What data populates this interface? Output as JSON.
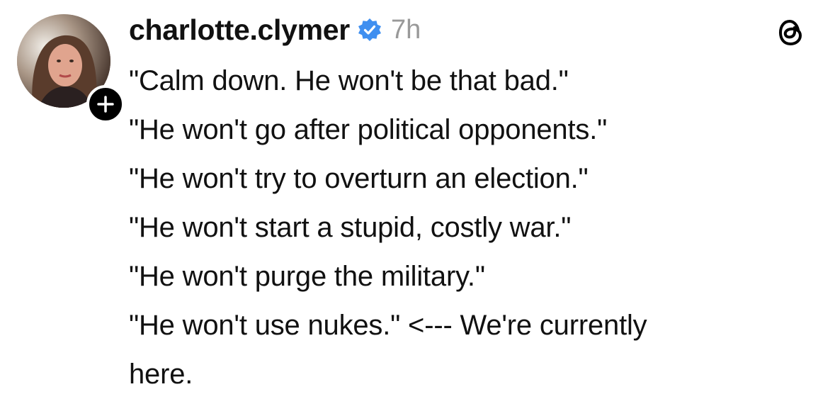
{
  "post": {
    "author": {
      "username": "charlotte.clymer",
      "verified": true,
      "avatar_icon": "profile-photo",
      "follow_icon": "plus-icon"
    },
    "timestamp": "7h",
    "lines": [
      "\"Calm down. He won't be that bad.\"",
      "\"He won't go after political opponents.\"",
      "\"He won't try to overturn an election.\"",
      "\"He won't start a stupid, costly war.\"",
      "\"He won't purge the military.\"",
      "\"He won't use nukes.\" <--- We're currently",
      "here."
    ]
  },
  "app": {
    "logo_icon": "threads-logo-icon"
  },
  "colors": {
    "text": "#111111",
    "timestamp": "#999999",
    "verified_badge": "#3f8ff0",
    "follow_badge": "#000000",
    "background": "#ffffff"
  }
}
